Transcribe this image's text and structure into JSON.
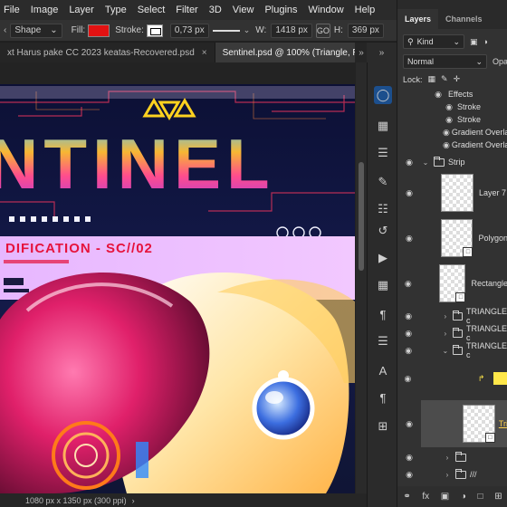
{
  "menu": [
    "File",
    "Image",
    "Layer",
    "Type",
    "Select",
    "Filter",
    "3D",
    "View",
    "Plugins",
    "Window",
    "Help"
  ],
  "options": {
    "tool_mode": "Shape",
    "fill_label": "Fill:",
    "fill_color": "#e31212",
    "stroke_label": "Stroke:",
    "stroke_width": "0,73 px",
    "w_label": "W:",
    "w_value": "1418 px",
    "link_icon": "GO",
    "h_label": "H:",
    "h_value": "369 px"
  },
  "tabs": [
    {
      "label": "xt Harus pake CC 2023 keatas-Recovered.psd",
      "active": false
    },
    {
      "label": "Sentinel.psd @ 100% (Triangle, RGB/8)",
      "active": true
    }
  ],
  "tab_more": "»",
  "artwork": {
    "title": "NTINEL",
    "subtitle": "DIFICATION - SC//02"
  },
  "status": {
    "dimensions": "1080 px x 1350 px (300 ppi)",
    "arrow": "›"
  },
  "tools": [
    "move-tool",
    "marquee-tool",
    "lasso-tool",
    "crop-tool",
    "eyedropper-tool",
    "spot-heal-tool",
    "brush-tool",
    "stamp-tool",
    "history-brush-tool",
    "eraser-tool",
    "gradient-tool",
    "blur-tool",
    "dodge-tool",
    "pen-tool",
    "type-tool",
    "path-select-tool",
    "shape-tool",
    "hand-tool"
  ],
  "layers_panel": {
    "tabs": [
      "Layers",
      "Channels"
    ],
    "kind_label": "Kind",
    "blend_mode": "Normal",
    "opacity_label": "Opa",
    "lock_label": "Lock:",
    "effects": [
      "Effects",
      "Stroke",
      "Stroke",
      "Gradient Overlay",
      "Gradient Overlay"
    ],
    "layers": [
      {
        "name": "Strip",
        "type": "group"
      },
      {
        "name": "Layer 7",
        "type": "pixel"
      },
      {
        "name": "Polygon",
        "type": "shape"
      },
      {
        "name": "Rectangle",
        "type": "shape"
      },
      {
        "name": "TRIANGLE c",
        "type": "group"
      },
      {
        "name": "TRIANGLE c",
        "type": "group"
      },
      {
        "name": "TRIANGLE c",
        "type": "group-open"
      },
      {
        "name": "",
        "type": "fill"
      },
      {
        "name": "Tri",
        "type": "shape-selected"
      },
      {
        "name": "",
        "type": "group"
      },
      {
        "name": "///",
        "type": "group"
      }
    ]
  }
}
